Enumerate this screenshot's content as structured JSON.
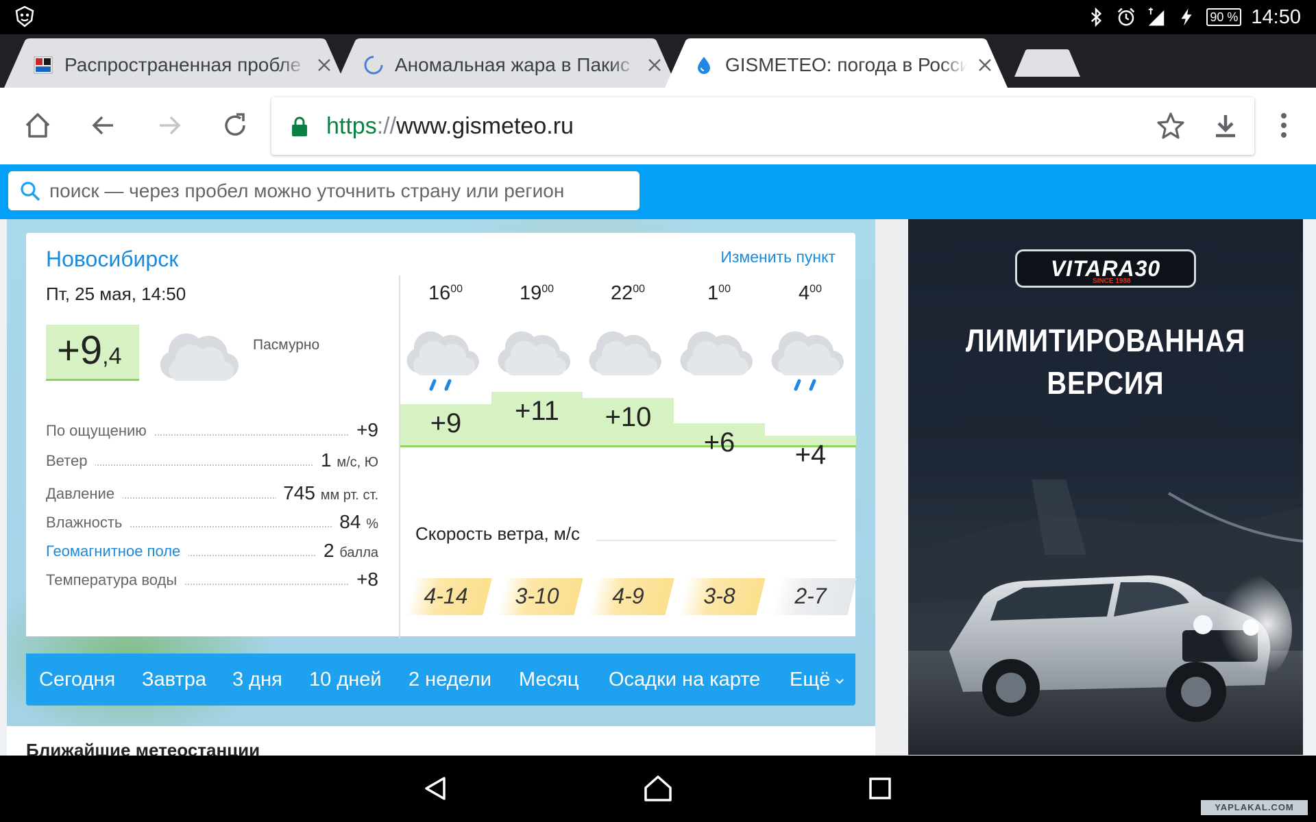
{
  "status_bar": {
    "time": "14:50",
    "battery": "90 %"
  },
  "tabs": [
    {
      "title": "Распространенная пробле",
      "state": "background",
      "favicon": "site-logo-icon"
    },
    {
      "title": "Аномальная жара в Пакис",
      "state": "loading",
      "favicon": "loading-spinner-icon"
    },
    {
      "title": "GISMETEO: погода в Росси",
      "state": "active",
      "favicon": "water-drop-icon"
    }
  ],
  "toolbar": {
    "url_scheme": "https",
    "url_sep": "://",
    "url_host": "www.gismeteo.ru"
  },
  "search": {
    "placeholder": "поиск — через пробел можно уточнить страну или регион"
  },
  "weather": {
    "city": "Новосибирск",
    "change_location": "Изменить пункт",
    "date": "Пт, 25 мая, 14:50",
    "current_temp": "+9",
    "current_temp_decimal": ",4",
    "condition": "Пасмурно",
    "details": [
      {
        "label": "По ощущению",
        "value": "+9",
        "unit": "",
        "link": false
      },
      {
        "label": "Ветер",
        "value": "1",
        "unit": "м/с, Ю",
        "link": false
      },
      {
        "label": "Давление",
        "value": "745",
        "unit": "мм рт. ст.",
        "link": false
      },
      {
        "label": "Влажность",
        "value": "84",
        "unit": "%",
        "link": false
      },
      {
        "label": "Геомагнитное поле",
        "value": "2",
        "unit": "балла",
        "link": true
      },
      {
        "label": "Температура воды",
        "value": "+8",
        "unit": "",
        "link": false
      }
    ],
    "forecast": [
      {
        "hour": "16",
        "min": "00",
        "icon": "cloud-rain-icon",
        "temp": "+9",
        "temp_c": 9,
        "wind": "4-14",
        "wind_level": "high"
      },
      {
        "hour": "19",
        "min": "00",
        "icon": "cloud-icon",
        "temp": "+11",
        "temp_c": 11,
        "wind": "3-10",
        "wind_level": "high"
      },
      {
        "hour": "22",
        "min": "00",
        "icon": "cloud-icon",
        "temp": "+10",
        "temp_c": 10,
        "wind": "4-9",
        "wind_level": "high"
      },
      {
        "hour": "1",
        "min": "00",
        "icon": "cloud-icon",
        "temp": "+6",
        "temp_c": 6,
        "wind": "3-8",
        "wind_level": "high"
      },
      {
        "hour": "4",
        "min": "00",
        "icon": "cloud-rain-icon",
        "temp": "+4",
        "temp_c": 4,
        "wind": "2-7",
        "wind_level": "low"
      }
    ],
    "wind_title": "Скорость ветра, м/с",
    "nav": [
      "Сегодня",
      "Завтра",
      "3 дня",
      "10 дней",
      "2 недели",
      "Месяц",
      "Осадки на карте",
      "Ещё"
    ],
    "nearby_title": "Ближайшие метеостанции"
  },
  "ad": {
    "logo": "VITARA30",
    "logo_sub": "SINCE 1988",
    "headline_1": "ЛИМИТИРОВАННАЯ",
    "headline_2": "ВЕРСИЯ"
  },
  "watermark": "YAPLAKAL.COM",
  "colors": {
    "accent": "#03a0f5",
    "link": "#1b8ad8",
    "temp_fill": "#d6f2c2",
    "wind_fill": "#fbdf8d"
  }
}
